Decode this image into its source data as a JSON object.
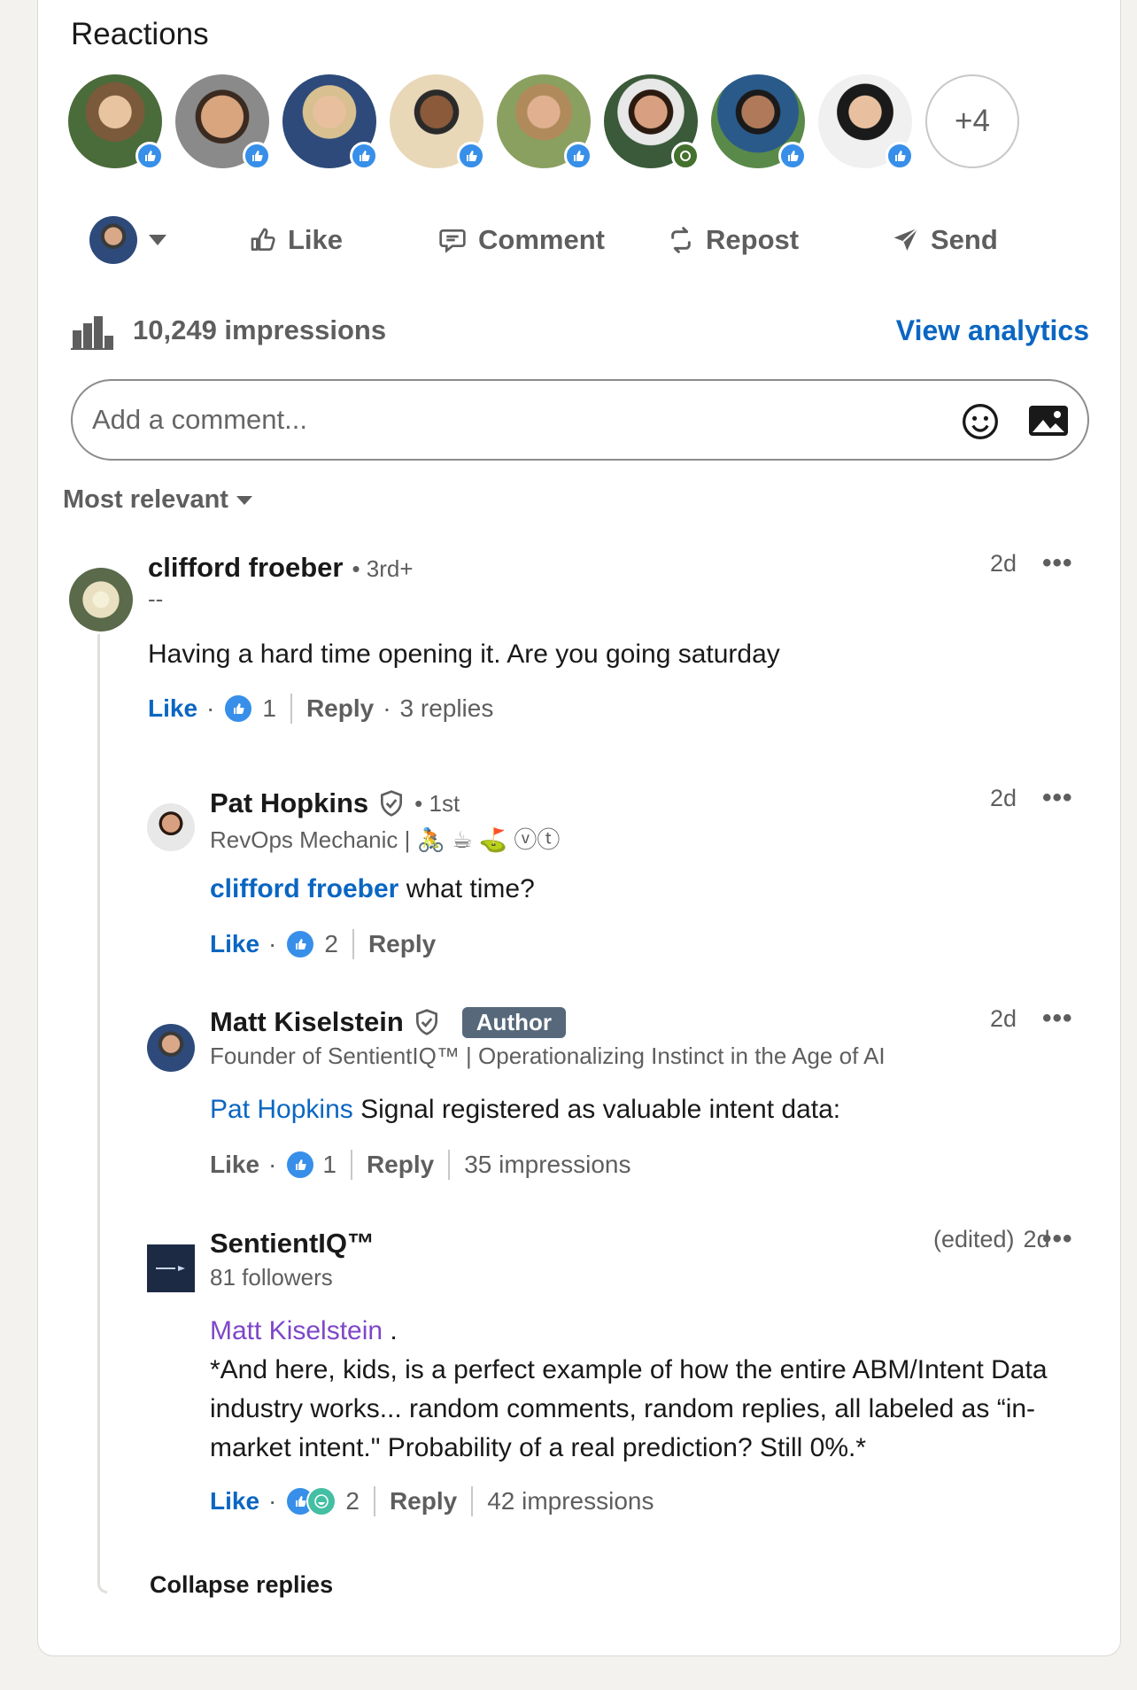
{
  "reactions": {
    "title": "Reactions",
    "more_label": "+4",
    "avatar_colors": [
      "#4a6b3a",
      "#8a6a4a",
      "#2d4a7a",
      "#c9a77a",
      "#b89a5a",
      "#3a5a3a",
      "#2a5a8a",
      "#303030"
    ]
  },
  "actions": {
    "like": "Like",
    "comment": "Comment",
    "repost": "Repost",
    "send": "Send"
  },
  "impressions": {
    "text": "10,249 impressions",
    "analytics_link": "View analytics"
  },
  "comment_input": {
    "placeholder": "Add a comment..."
  },
  "sort": {
    "label": "Most relevant"
  },
  "comments": [
    {
      "name": "clifford froeber",
      "degree": "• 3rd+",
      "headline": "--",
      "time": "2d",
      "text": "Having a hard time opening it. Are you going saturday",
      "like_label": "Like",
      "reaction_count": "1",
      "reply_label": "Reply",
      "replies_label": "3 replies"
    }
  ],
  "replies": [
    {
      "name": "Pat Hopkins",
      "degree": "• 1st",
      "headline": "RevOps Mechanic | 🚴 ☕ ⛳ ⓥⓣ",
      "time": "2d",
      "mention": "clifford froeber",
      "text": " what time?",
      "like_label": "Like",
      "reaction_count": "2",
      "reply_label": "Reply"
    },
    {
      "name": "Matt Kiselstein",
      "badge": "Author",
      "headline": "Founder of SentientIQ™ | Operationalizing Instinct in the Age of AI",
      "time": "2d",
      "mention": "Pat Hopkins",
      "text": " Signal registered as valuable intent data:",
      "like_label": "Like",
      "reaction_count": "1",
      "reply_label": "Reply",
      "impressions": "35 impressions"
    },
    {
      "name": "SentientIQ™",
      "headline": "81 followers",
      "edited": "(edited)",
      "time": "2d",
      "mention": "Matt Kiselstein",
      "mention_suffix": " .",
      "text": "*And here, kids, is a perfect example of how the entire ABM/Intent Data industry works... random comments, random replies, all labeled as “in-market intent.\" Probability of a real prediction? Still 0%.*",
      "like_label": "Like",
      "reaction_count": "2",
      "reply_label": "Reply",
      "impressions": "42 impressions"
    }
  ],
  "collapse_label": "Collapse replies",
  "dots": "•••"
}
